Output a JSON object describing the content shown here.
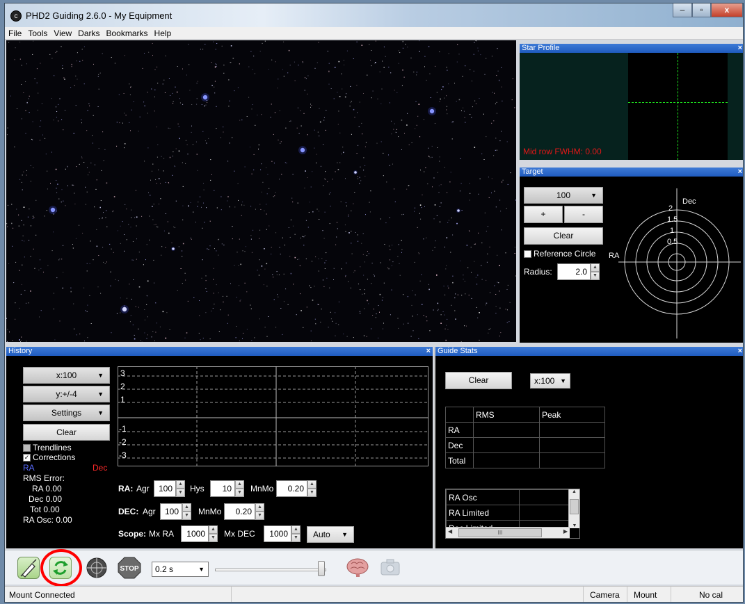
{
  "window": {
    "title": "PHD2 Guiding 2.6.0 - My Equipment",
    "app_icon": "c",
    "min_glyph": "‒",
    "max_glyph": "▫",
    "close_glyph": "x"
  },
  "menu": [
    "File",
    "Tools",
    "View",
    "Darks",
    "Bookmarks",
    "Help"
  ],
  "star_profile": {
    "title": "Star Profile",
    "close": "×",
    "fwhm": "Mid row FWHM: 0.00"
  },
  "target": {
    "title": "Target",
    "close": "×",
    "zoom": "100",
    "plus": "+",
    "minus": "-",
    "clear": "Clear",
    "ref_circle": "Reference Circle",
    "radius_label": "Radius:",
    "radius_value": "2.0",
    "rings": [
      "2",
      "1.5",
      "1",
      "0.5"
    ],
    "dec_label": "Dec",
    "ra_label": "RA"
  },
  "history": {
    "title": "History",
    "close": "×",
    "x_scale": "x:100",
    "y_scale": "y:+/-4",
    "settings": "Settings",
    "clear": "Clear",
    "trendlines": "Trendlines",
    "corrections": "Corrections",
    "check": "✓",
    "ra": "RA",
    "dec": "Dec",
    "rms_error": "RMS Error:",
    "ra_rms": "RA 0.00",
    "dec_rms": "Dec 0.00",
    "tot_rms": "Tot 0.00",
    "ra_osc": "RA Osc: 0.00",
    "y_ticks": [
      "3",
      "2",
      "1",
      "-1",
      "-2",
      "-3"
    ],
    "ra_label": "RA:",
    "agr": "Agr",
    "ra_agr": "100",
    "hys": "Hys",
    "hys_value": "10",
    "mnmo": "MnMo",
    "ra_mnmo": "0.20",
    "dec_label": "DEC:",
    "dec_agr": "100",
    "dec_mnmo": "0.20",
    "scope_label": "Scope:",
    "mx_ra": "Mx RA",
    "mx_ra_value": "1000",
    "mx_dec": "Mx DEC",
    "mx_dec_value": "1000",
    "auto": "Auto"
  },
  "guide_stats": {
    "title": "Guide Stats",
    "close": "×",
    "clear": "Clear",
    "scale": "x:100",
    "headers": [
      "RMS",
      "Peak"
    ],
    "rows": [
      "RA",
      "Dec",
      "Total"
    ],
    "list": [
      "RA Osc",
      "RA Limited",
      "Dec Limited"
    ],
    "scroll_thumb": "III"
  },
  "toolbar": {
    "exposure": "0.2 s",
    "stop": "STOP"
  },
  "status": {
    "left": "Mount Connected",
    "camera": "Camera",
    "mount": "Mount",
    "cal": "No cal"
  },
  "colors": {
    "ra": "#5a6cff",
    "dec": "#ff2a2a",
    "fwhm": "#e01818",
    "crosshair": "#1ee01e",
    "highlight": "#ff0000"
  }
}
